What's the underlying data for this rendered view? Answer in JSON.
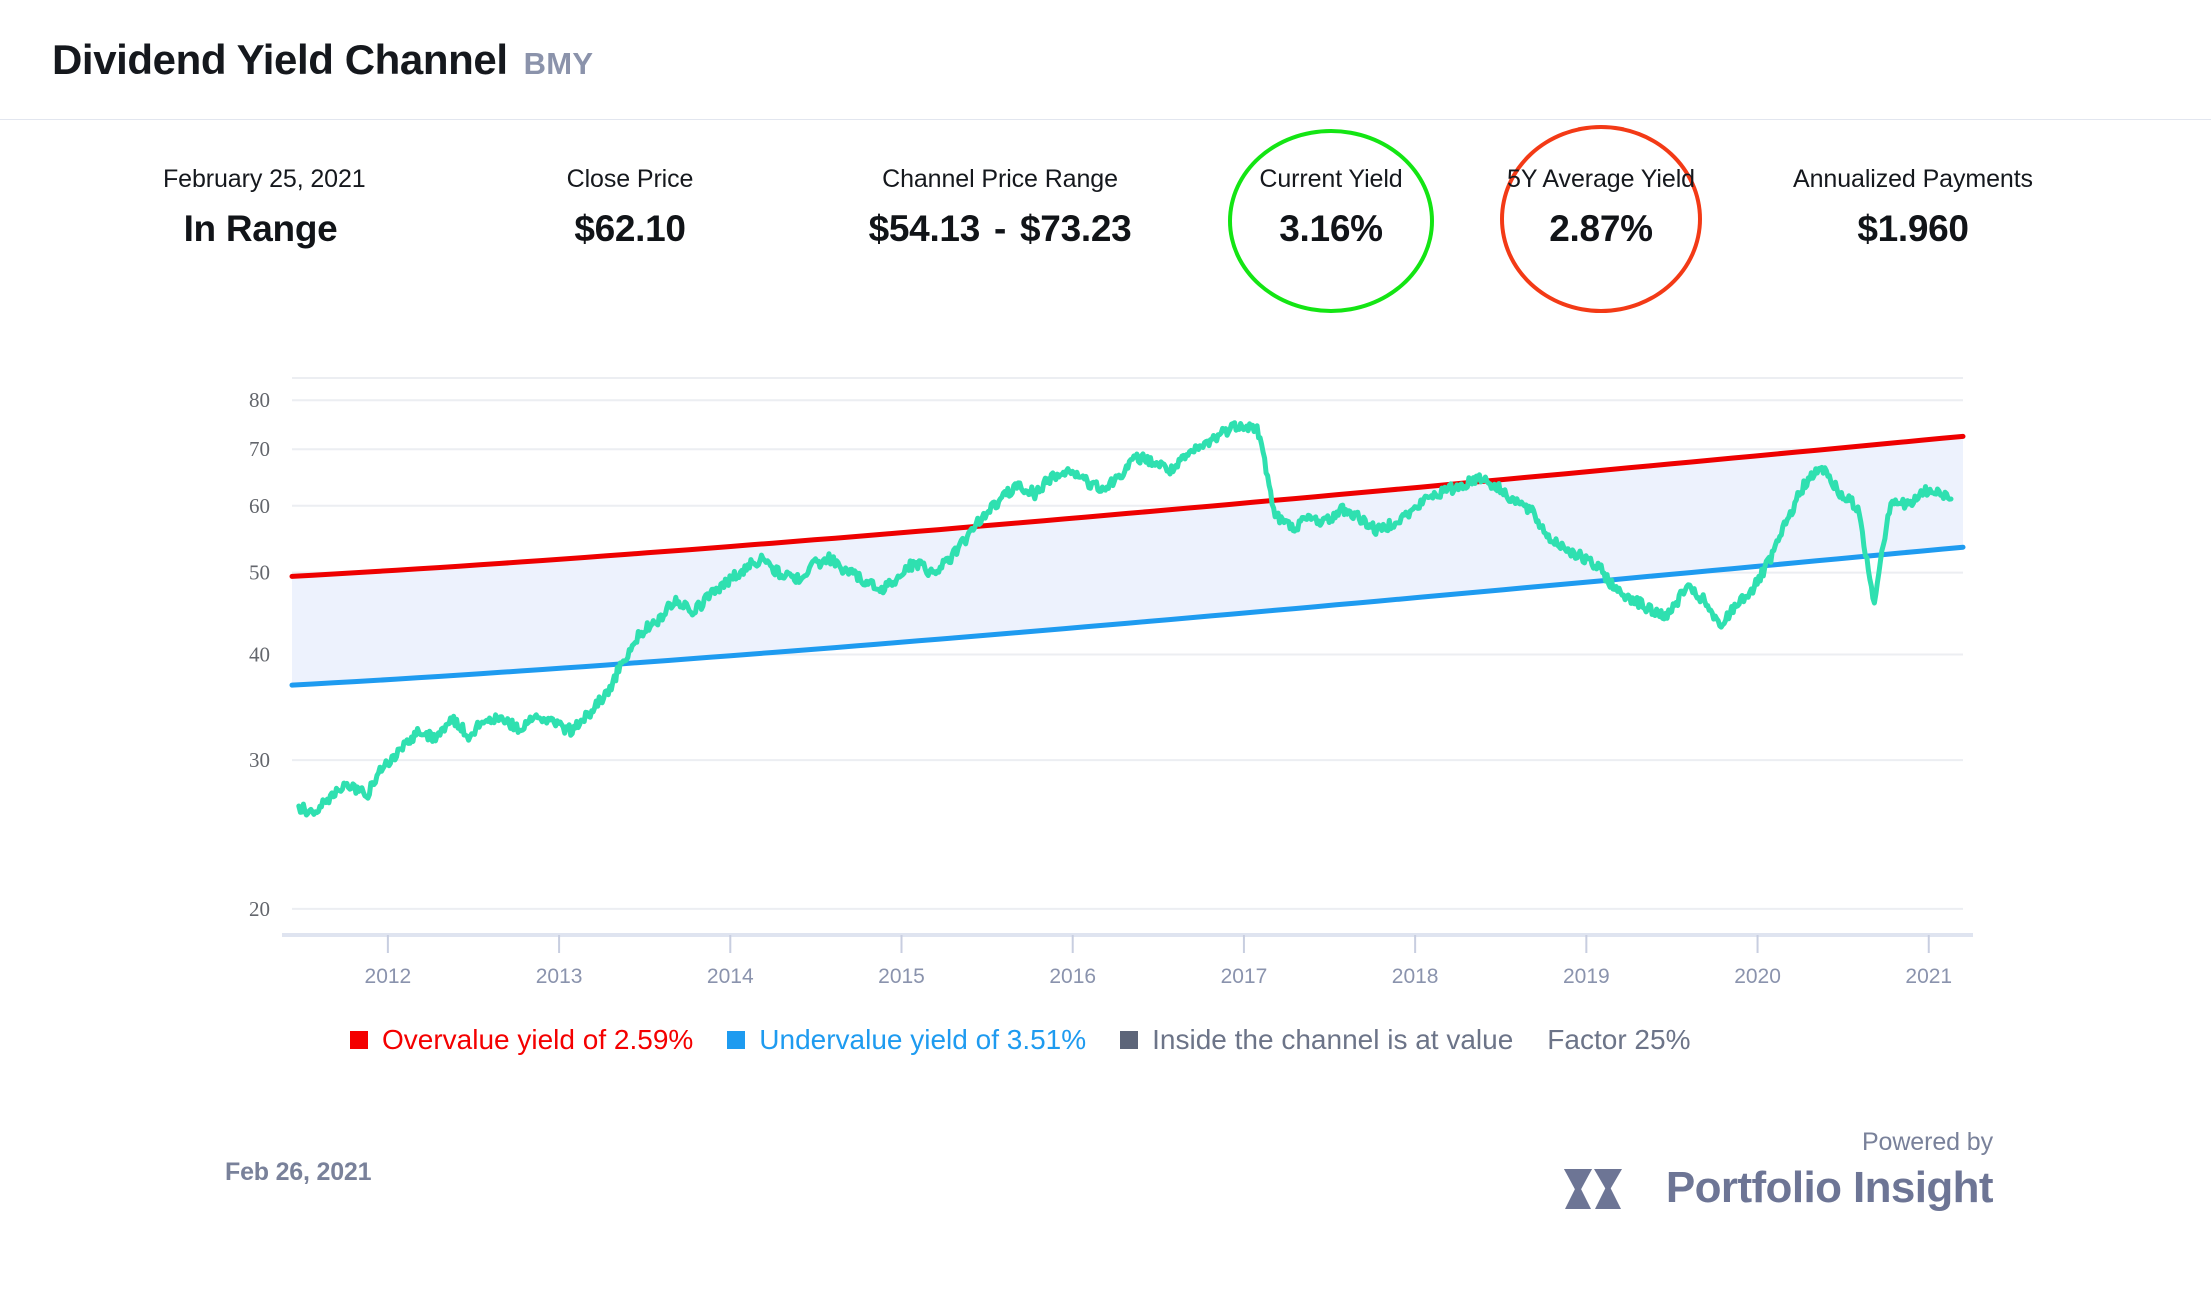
{
  "header": {
    "title": "Dividend Yield Channel",
    "ticker": "BMY"
  },
  "metrics": [
    {
      "label": "February 25, 2021",
      "value": "In Range"
    },
    {
      "label": "Close Price",
      "value": "$62.10"
    },
    {
      "label": "Channel Price Range",
      "value_low": "$54.13",
      "dash": "-",
      "value_high": "$73.23"
    },
    {
      "label": "Current Yield",
      "value": "3.16%",
      "circle_color": "#13e513"
    },
    {
      "label": "5Y Average Yield",
      "value": "2.87%",
      "circle_color": "#f33a16"
    },
    {
      "label": "Annualized Payments",
      "value": "$1.960"
    }
  ],
  "legend": [
    {
      "label": "Overvalue yield of 2.59%",
      "color": "#f40000",
      "marker": true
    },
    {
      "label": "Undervalue yield of 3.51%",
      "color": "#1e9bf0",
      "marker": true
    },
    {
      "label": "Inside the channel is at value",
      "color": "#6c7488",
      "marker": true
    },
    {
      "label": "Factor 25%",
      "color": "#6c7488",
      "marker": false
    }
  ],
  "footer": {
    "date": "Feb 26, 2021",
    "powered_by": "Powered by",
    "brand": "Portfolio Insight",
    "logo_icon": "mountain-w-icon"
  },
  "chart_data": {
    "type": "line",
    "title": "",
    "xlabel": "",
    "ylabel": "",
    "grid": true,
    "yscale": "log",
    "ylim": [
      20,
      85
    ],
    "yticks": [
      20,
      30,
      40,
      50,
      60,
      70,
      80
    ],
    "ytick_labels": [
      "20",
      "30",
      "40",
      "50",
      "60",
      "70",
      "80"
    ],
    "xlim": [
      "2011-06",
      "2021-03"
    ],
    "xticks": [
      "2012",
      "2013",
      "2014",
      "2015",
      "2016",
      "2017",
      "2018",
      "2019",
      "2020",
      "2021"
    ],
    "series": [
      {
        "name": "Price",
        "color": "#2fe0b0",
        "x": [
          "2011.5",
          "2011.6",
          "2011.7",
          "2011.8",
          "2011.9",
          "2012.0",
          "2012.1",
          "2012.2",
          "2012.3",
          "2012.4",
          "2012.5",
          "2012.6",
          "2012.7",
          "2012.8",
          "2012.9",
          "2013.0",
          "2013.1",
          "2013.2",
          "2013.3",
          "2013.4",
          "2013.5",
          "2013.6",
          "2013.7",
          "2013.8",
          "2013.9",
          "2014.0",
          "2014.1",
          "2014.2",
          "2014.3",
          "2014.4",
          "2014.5",
          "2014.6",
          "2014.7",
          "2014.8",
          "2014.9",
          "2015.0",
          "2015.1",
          "2015.2",
          "2015.3",
          "2015.4",
          "2015.5",
          "2015.6",
          "2015.7",
          "2015.8",
          "2015.9",
          "2016.0",
          "2016.1",
          "2016.2",
          "2016.3",
          "2016.4",
          "2016.5",
          "2016.6",
          "2016.7",
          "2016.8",
          "2016.9",
          "2017.0",
          "2017.1",
          "2017.2",
          "2017.3",
          "2017.4",
          "2017.5",
          "2017.6",
          "2017.7",
          "2017.8",
          "2017.9",
          "2018.0",
          "2018.1",
          "2018.2",
          "2018.3",
          "2018.4",
          "2018.5",
          "2018.6",
          "2018.7",
          "2018.8",
          "2018.9",
          "2019.0",
          "2019.1",
          "2019.2",
          "2019.3",
          "2019.4",
          "2019.5",
          "2019.6",
          "2019.7",
          "2019.8",
          "2019.9",
          "2020.0",
          "2020.1",
          "2020.2",
          "2020.3",
          "2020.4",
          "2020.5",
          "2020.6",
          "2020.7",
          "2020.8",
          "2020.9",
          "2021.0",
          "2021.15"
        ],
        "y": [
          26.3,
          26.0,
          27.4,
          28.0,
          27.3,
          29.6,
          31.0,
          32.5,
          31.9,
          33.5,
          32.0,
          33.8,
          33.3,
          32.6,
          34.0,
          33.0,
          32.5,
          34.2,
          36.0,
          39.5,
          42.5,
          44.0,
          46.5,
          44.8,
          47.0,
          48.8,
          50.5,
          52.0,
          50.0,
          49.0,
          51.0,
          52.0,
          50.2,
          49.0,
          47.5,
          49.5,
          51.5,
          50.0,
          51.8,
          55.0,
          58.5,
          61.0,
          63.5,
          62.0,
          65.0,
          66.0,
          64.0,
          62.5,
          65.5,
          68.5,
          67.5,
          66.0,
          69.0,
          71.0,
          73.5,
          75.0,
          74.0,
          58.5,
          56.5,
          58.0,
          57.5,
          59.5,
          58.0,
          56.0,
          57.5,
          59.0,
          61.5,
          62.5,
          63.5,
          65.0,
          63.0,
          61.0,
          59.0,
          55.0,
          53.5,
          52.0,
          50.5,
          47.5,
          46.5,
          45.0,
          44.5,
          48.0,
          46.5,
          43.0,
          46.0,
          48.0,
          52.0,
          58.0,
          64.0,
          66.5,
          62.0,
          60.0,
          46.0,
          61.0,
          60.0,
          62.5,
          61.5
        ]
      },
      {
        "name": "Overvalue channel line",
        "color": "#ee0000",
        "y_start": 49.5,
        "y_end": 72.5
      },
      {
        "name": "Undervalue channel line",
        "color": "#1e9bf0",
        "y_start": 36.8,
        "y_end": 53.6
      }
    ],
    "channel_fill": "#edf2fd"
  }
}
